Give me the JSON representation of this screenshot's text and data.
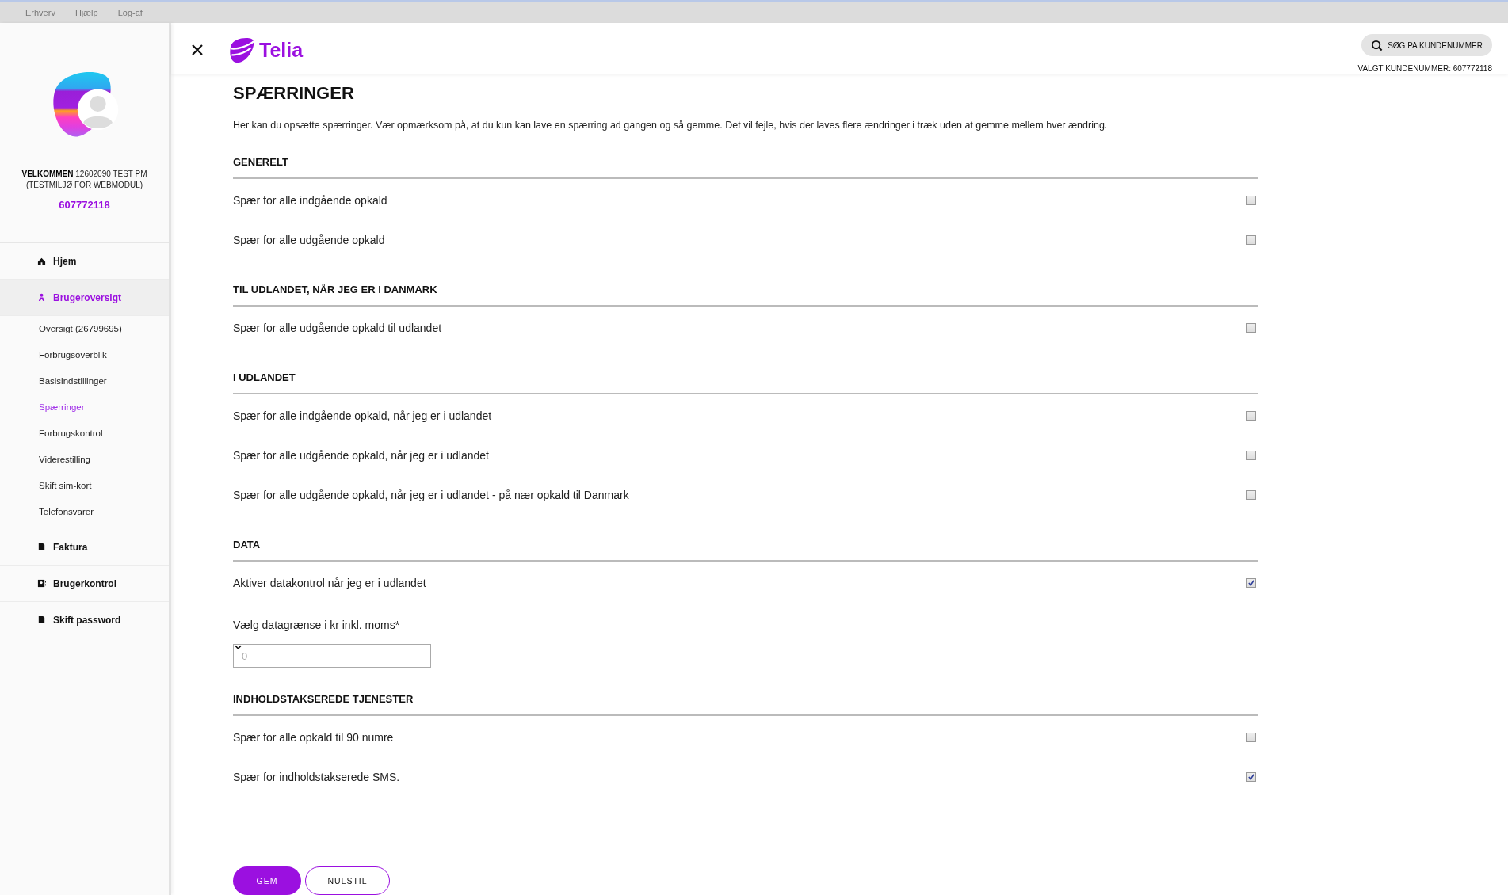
{
  "top_bar": {
    "links": [
      "Erhverv",
      "Hjælp",
      "Log-af"
    ]
  },
  "sidebar": {
    "welcome": "**VELKOMMEN** 12602090 TEST PM (TESTMILJØ FOR WEBMODUL)",
    "customer_number": "607772118",
    "items": [
      {
        "label": "Hjem",
        "kind": "home",
        "selected": false
      },
      {
        "label": "Brugeroversigt",
        "kind": "person",
        "selected": true,
        "children": [
          {
            "label": "Oversigt (26799695)",
            "selected": false
          },
          {
            "label": "Forbrugsoverblik",
            "selected": false
          },
          {
            "label": "Basisindstillinger",
            "selected": false
          },
          {
            "label": "Spærringer",
            "selected": true
          },
          {
            "label": "Forbrugskontrol",
            "selected": false
          },
          {
            "label": "Viderestilling",
            "selected": false
          },
          {
            "label": "Skift sim-kort",
            "selected": false
          },
          {
            "label": "Telefonsvarer",
            "selected": false
          }
        ]
      },
      {
        "label": "Faktura",
        "kind": "document",
        "selected": false
      },
      {
        "label": "Brugerkontrol",
        "kind": "contact",
        "selected": false
      },
      {
        "label": "Skift password",
        "kind": "document",
        "selected": false
      }
    ]
  },
  "header": {
    "logo_text": "Telia",
    "search_button": "SØG PA KUNDENUMMER",
    "selected_customer": "VALGT KUNDENUMMER: 607772118"
  },
  "page": {
    "title": "SPÆRRINGER",
    "intro": "Her kan du opsætte spærringer. Vær opmærksom på, at du kun kan lave en spærring ad gangen og så gemme. Det vil fejle, hvis der laves flere ændringer i træk uden at gemme mellem hver ændring.",
    "sections": [
      {
        "title": "GENERELT",
        "items": [
          {
            "kind": "checkbox",
            "label": "Spær for alle indgående opkald",
            "checked": false
          },
          {
            "kind": "checkbox",
            "label": "Spær for alle udgående opkald",
            "checked": false
          }
        ]
      },
      {
        "title": "TIL UDLANDET, NÅR JEG ER I DANMARK",
        "items": [
          {
            "kind": "checkbox",
            "label": "Spær for alle udgående opkald til udlandet",
            "checked": false
          }
        ]
      },
      {
        "title": "I UDLANDET",
        "items": [
          {
            "kind": "checkbox",
            "label": "Spær for alle indgående opkald, når jeg er i udlandet",
            "checked": false
          },
          {
            "kind": "checkbox",
            "label": "Spær for alle udgående opkald, når jeg er i udlandet",
            "checked": false
          },
          {
            "kind": "checkbox",
            "label": "Spær for alle udgående opkald, når jeg er i udlandet - på nær opkald til Danmark",
            "checked": false
          }
        ]
      },
      {
        "title": "DATA",
        "items": [
          {
            "kind": "checkbox",
            "label": "Aktiver datakontrol når jeg er i udlandet",
            "checked": true
          },
          {
            "kind": "select",
            "label": "Vælg datagrænse i kr inkl. moms*",
            "placeholder": "0"
          }
        ]
      },
      {
        "title": "INDHOLDSTAKSEREDE TJENESTER",
        "items": [
          {
            "kind": "checkbox",
            "label": "Spær for alle opkald til 90 numre",
            "checked": false
          },
          {
            "kind": "checkbox",
            "label": "Spær for indholdstakserede SMS.",
            "checked": true
          }
        ]
      }
    ],
    "buttons": [
      {
        "label": "GEM",
        "kind": "primary"
      },
      {
        "label": "NULSTIL",
        "kind": "secondary"
      }
    ]
  }
}
